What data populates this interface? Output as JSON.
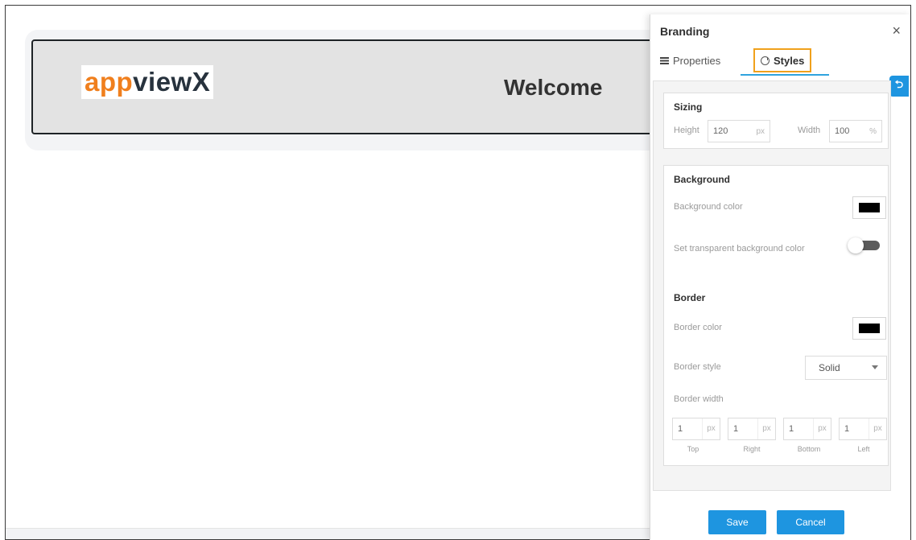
{
  "banner": {
    "logo_part1": "app",
    "logo_part2": "viewX",
    "welcome": "Welcome"
  },
  "panel": {
    "title": "Branding",
    "close_icon": "×",
    "tabs": [
      {
        "label": "Properties",
        "icon": "properties-icon"
      },
      {
        "label": "Styles",
        "icon": "styles-icon",
        "active": true
      }
    ],
    "side_button_icon": "undo-icon",
    "side_button_glyph": "⮌"
  },
  "sizing": {
    "title": "Sizing",
    "height_label": "Height",
    "height_value": "120",
    "height_unit": "px",
    "width_label": "Width",
    "width_value": "100",
    "width_unit": "%"
  },
  "background": {
    "title": "Background",
    "color_label": "Background color",
    "color_value": "#000000",
    "transparent_label": "Set transparent background color",
    "transparent_on": false
  },
  "border": {
    "title": "Border",
    "color_label": "Border color",
    "color_value": "#000000",
    "style_label": "Border style",
    "style_value": "Solid",
    "width_label": "Border width",
    "widths": [
      {
        "value": "1",
        "unit": "px",
        "caption": "Top"
      },
      {
        "value": "1",
        "unit": "px",
        "caption": "Right"
      },
      {
        "value": "1",
        "unit": "px",
        "caption": "Bottom"
      },
      {
        "value": "1",
        "unit": "px",
        "caption": "Left"
      }
    ]
  },
  "actions": {
    "save": "Save",
    "cancel": "Cancel"
  },
  "colors": {
    "accent": "#1e95e0",
    "logo_orange": "#f07f1d",
    "tab_highlight": "#f0a11c"
  }
}
